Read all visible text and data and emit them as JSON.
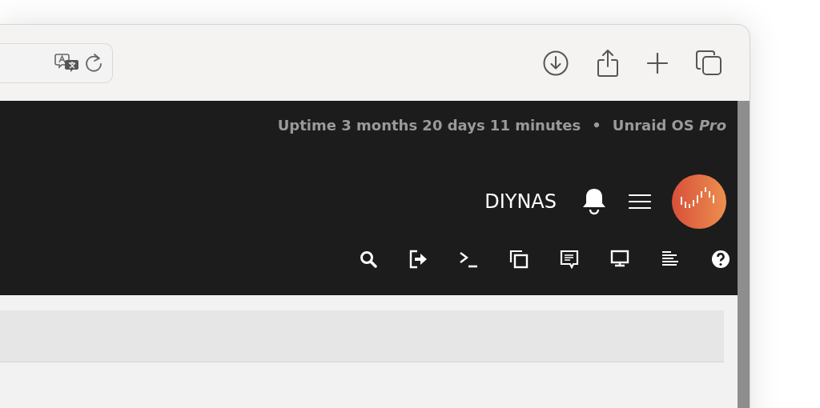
{
  "header": {
    "uptime": "Uptime 3 months 20 days 11 minutes",
    "separator": "•",
    "edition": "Unraid OS *Pro*",
    "server_name": "DIYNAS"
  }
}
